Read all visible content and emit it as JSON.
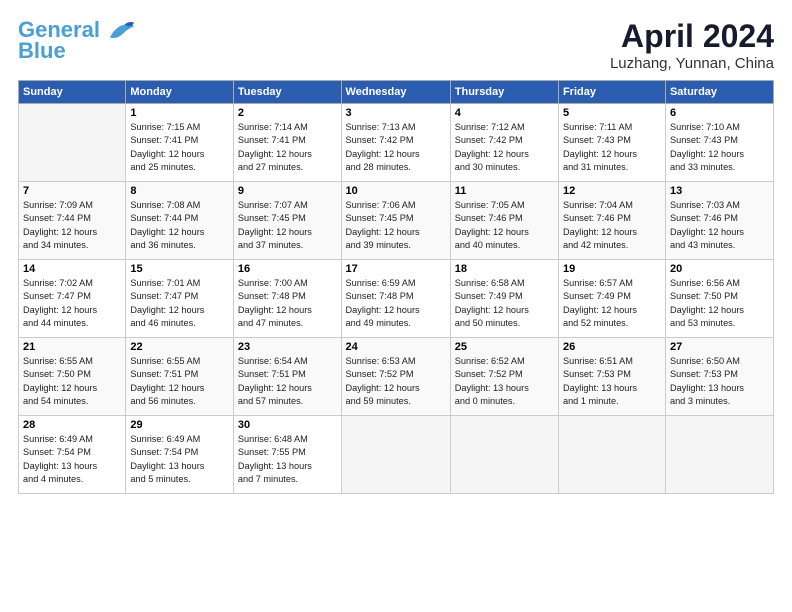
{
  "header": {
    "logo_line1": "General",
    "logo_line2": "Blue",
    "title": "April 2024",
    "subtitle": "Luzhang, Yunnan, China"
  },
  "weekdays": [
    "Sunday",
    "Monday",
    "Tuesday",
    "Wednesday",
    "Thursday",
    "Friday",
    "Saturday"
  ],
  "weeks": [
    [
      {
        "day": "",
        "info": ""
      },
      {
        "day": "1",
        "info": "Sunrise: 7:15 AM\nSunset: 7:41 PM\nDaylight: 12 hours\nand 25 minutes."
      },
      {
        "day": "2",
        "info": "Sunrise: 7:14 AM\nSunset: 7:41 PM\nDaylight: 12 hours\nand 27 minutes."
      },
      {
        "day": "3",
        "info": "Sunrise: 7:13 AM\nSunset: 7:42 PM\nDaylight: 12 hours\nand 28 minutes."
      },
      {
        "day": "4",
        "info": "Sunrise: 7:12 AM\nSunset: 7:42 PM\nDaylight: 12 hours\nand 30 minutes."
      },
      {
        "day": "5",
        "info": "Sunrise: 7:11 AM\nSunset: 7:43 PM\nDaylight: 12 hours\nand 31 minutes."
      },
      {
        "day": "6",
        "info": "Sunrise: 7:10 AM\nSunset: 7:43 PM\nDaylight: 12 hours\nand 33 minutes."
      }
    ],
    [
      {
        "day": "7",
        "info": "Sunrise: 7:09 AM\nSunset: 7:44 PM\nDaylight: 12 hours\nand 34 minutes."
      },
      {
        "day": "8",
        "info": "Sunrise: 7:08 AM\nSunset: 7:44 PM\nDaylight: 12 hours\nand 36 minutes."
      },
      {
        "day": "9",
        "info": "Sunrise: 7:07 AM\nSunset: 7:45 PM\nDaylight: 12 hours\nand 37 minutes."
      },
      {
        "day": "10",
        "info": "Sunrise: 7:06 AM\nSunset: 7:45 PM\nDaylight: 12 hours\nand 39 minutes."
      },
      {
        "day": "11",
        "info": "Sunrise: 7:05 AM\nSunset: 7:46 PM\nDaylight: 12 hours\nand 40 minutes."
      },
      {
        "day": "12",
        "info": "Sunrise: 7:04 AM\nSunset: 7:46 PM\nDaylight: 12 hours\nand 42 minutes."
      },
      {
        "day": "13",
        "info": "Sunrise: 7:03 AM\nSunset: 7:46 PM\nDaylight: 12 hours\nand 43 minutes."
      }
    ],
    [
      {
        "day": "14",
        "info": "Sunrise: 7:02 AM\nSunset: 7:47 PM\nDaylight: 12 hours\nand 44 minutes."
      },
      {
        "day": "15",
        "info": "Sunrise: 7:01 AM\nSunset: 7:47 PM\nDaylight: 12 hours\nand 46 minutes."
      },
      {
        "day": "16",
        "info": "Sunrise: 7:00 AM\nSunset: 7:48 PM\nDaylight: 12 hours\nand 47 minutes."
      },
      {
        "day": "17",
        "info": "Sunrise: 6:59 AM\nSunset: 7:48 PM\nDaylight: 12 hours\nand 49 minutes."
      },
      {
        "day": "18",
        "info": "Sunrise: 6:58 AM\nSunset: 7:49 PM\nDaylight: 12 hours\nand 50 minutes."
      },
      {
        "day": "19",
        "info": "Sunrise: 6:57 AM\nSunset: 7:49 PM\nDaylight: 12 hours\nand 52 minutes."
      },
      {
        "day": "20",
        "info": "Sunrise: 6:56 AM\nSunset: 7:50 PM\nDaylight: 12 hours\nand 53 minutes."
      }
    ],
    [
      {
        "day": "21",
        "info": "Sunrise: 6:55 AM\nSunset: 7:50 PM\nDaylight: 12 hours\nand 54 minutes."
      },
      {
        "day": "22",
        "info": "Sunrise: 6:55 AM\nSunset: 7:51 PM\nDaylight: 12 hours\nand 56 minutes."
      },
      {
        "day": "23",
        "info": "Sunrise: 6:54 AM\nSunset: 7:51 PM\nDaylight: 12 hours\nand 57 minutes."
      },
      {
        "day": "24",
        "info": "Sunrise: 6:53 AM\nSunset: 7:52 PM\nDaylight: 12 hours\nand 59 minutes."
      },
      {
        "day": "25",
        "info": "Sunrise: 6:52 AM\nSunset: 7:52 PM\nDaylight: 13 hours\nand 0 minutes."
      },
      {
        "day": "26",
        "info": "Sunrise: 6:51 AM\nSunset: 7:53 PM\nDaylight: 13 hours\nand 1 minute."
      },
      {
        "day": "27",
        "info": "Sunrise: 6:50 AM\nSunset: 7:53 PM\nDaylight: 13 hours\nand 3 minutes."
      }
    ],
    [
      {
        "day": "28",
        "info": "Sunrise: 6:49 AM\nSunset: 7:54 PM\nDaylight: 13 hours\nand 4 minutes."
      },
      {
        "day": "29",
        "info": "Sunrise: 6:49 AM\nSunset: 7:54 PM\nDaylight: 13 hours\nand 5 minutes."
      },
      {
        "day": "30",
        "info": "Sunrise: 6:48 AM\nSunset: 7:55 PM\nDaylight: 13 hours\nand 7 minutes."
      },
      {
        "day": "",
        "info": ""
      },
      {
        "day": "",
        "info": ""
      },
      {
        "day": "",
        "info": ""
      },
      {
        "day": "",
        "info": ""
      }
    ]
  ]
}
